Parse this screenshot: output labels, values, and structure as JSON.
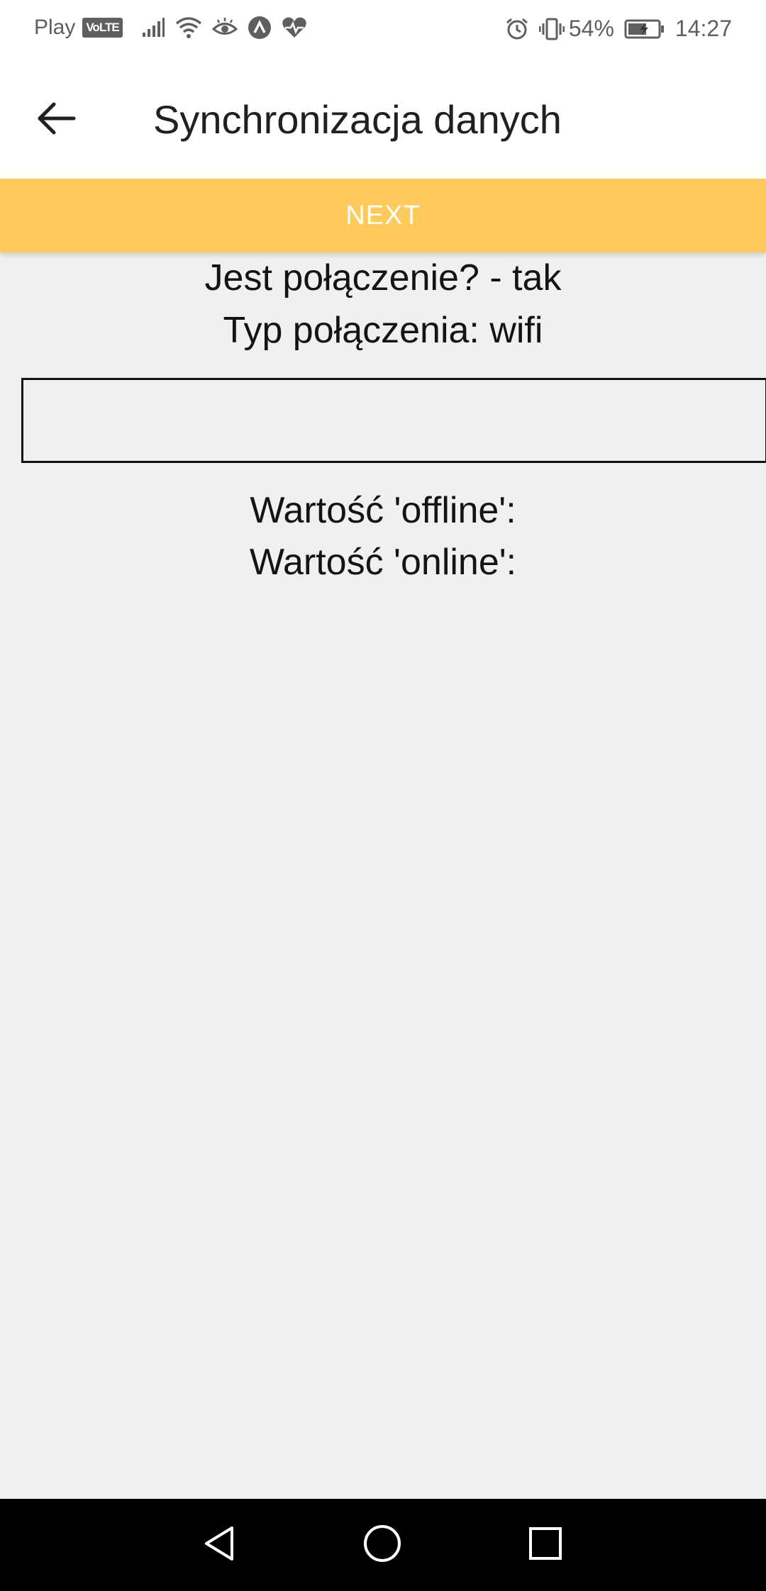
{
  "status_bar": {
    "carrier": "Play",
    "volte_badge": "VoLTE",
    "battery_percent": "54%",
    "time": "14:27",
    "icons": [
      "signal-icon",
      "wifi-icon",
      "eye-icon",
      "app-icon",
      "heart-rate-icon",
      "alarm-icon",
      "vibrate-icon",
      "battery-charging-icon"
    ]
  },
  "app_bar": {
    "back_icon": "arrow-left-icon",
    "title": "Synchronizacja danych"
  },
  "next_button": {
    "label": "NEXT",
    "color": "#fdca5b"
  },
  "content": {
    "connection_line": "Jest połączenie? - tak",
    "connection_type_line": "Typ połączenia: wifi",
    "input_value": "",
    "offline_value_line": "Wartość 'offline':",
    "online_value_line": "Wartość 'online':"
  },
  "nav_bar": {
    "icons": [
      "back-triangle-icon",
      "home-circle-icon",
      "recents-square-icon"
    ]
  }
}
